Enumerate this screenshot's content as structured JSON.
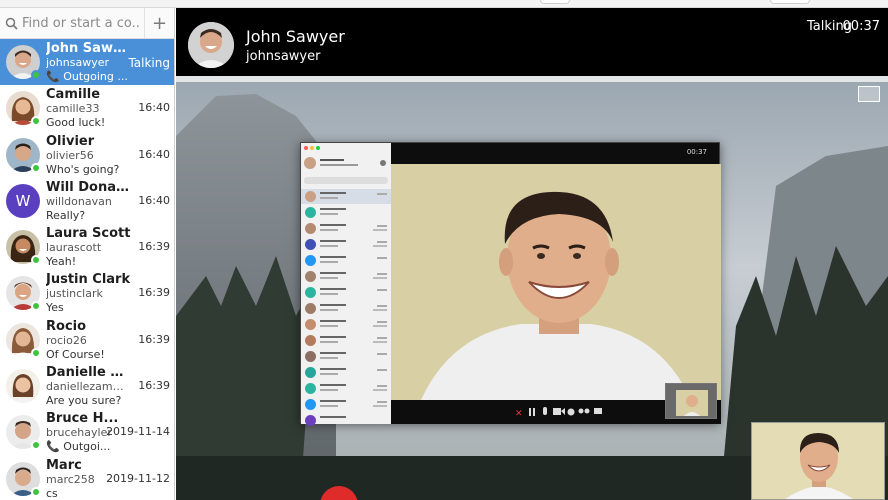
{
  "search": {
    "placeholder": "Find or start a co..."
  },
  "contacts": [
    {
      "name": "John Sawyer",
      "username": "johnsawyer",
      "last": "📞 Outgoing ...",
      "time": "Talking",
      "active": true
    },
    {
      "name": "Camille",
      "username": "camille33",
      "last": "Good luck!",
      "time": "16:40"
    },
    {
      "name": "Olivier",
      "username": "olivier56",
      "last": "Who's going?",
      "time": "16:40"
    },
    {
      "name": "Will Donavan",
      "username": "willdonavan",
      "last": "Really?",
      "time": "16:40",
      "avatar_letter": "W"
    },
    {
      "name": "Laura Scott",
      "username": "laurascott",
      "last": "Yeah!",
      "time": "16:39"
    },
    {
      "name": "Justin Clark",
      "username": "justinclark",
      "last": "Yes",
      "time": "16:39"
    },
    {
      "name": "Rocio",
      "username": "rocio26",
      "last": "Of Course!",
      "time": "16:39"
    },
    {
      "name": "Danielle Za...",
      "username": "daniellezambra",
      "last": "Are you sure?",
      "time": "16:39"
    },
    {
      "name": "Bruce H...",
      "username": "brucehayler",
      "last": "📞 Outgoi...",
      "time": "2019-11-14"
    },
    {
      "name": "Marc",
      "username": "marc258",
      "last": "cs",
      "time": "2019-11-12"
    }
  ],
  "call": {
    "name": "John Sawyer",
    "username": "johnsawyer",
    "status": "Talking",
    "duration": "00:37",
    "shared_time": "00:37"
  },
  "colors": {
    "accent": "#4a90d9",
    "online": "#3ec33e",
    "end_call": "#e02b2b"
  }
}
